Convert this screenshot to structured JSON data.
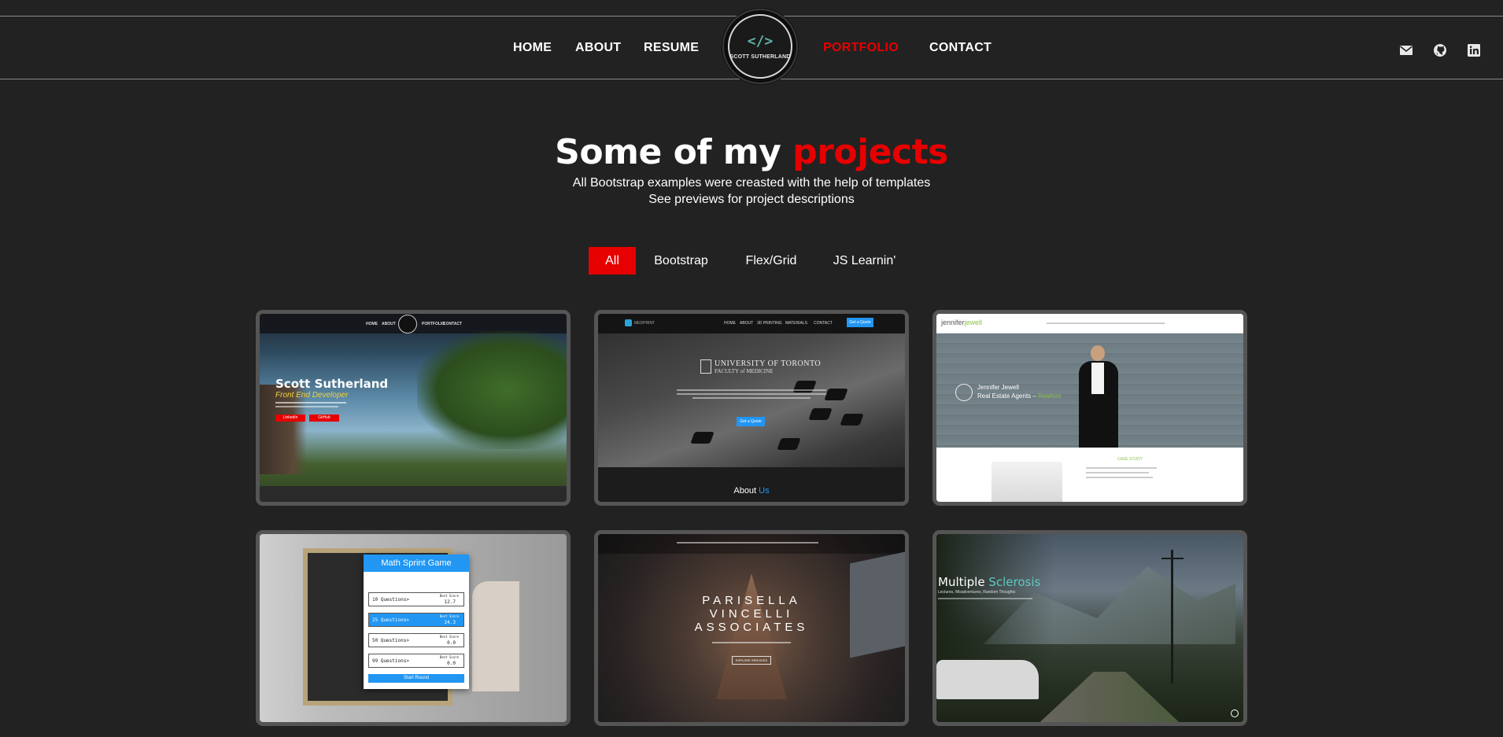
{
  "nav": {
    "left": [
      "HOME",
      "ABOUT",
      "RESUME"
    ],
    "right": [
      "PORTFOLIO",
      "CONTACT"
    ],
    "active": "PORTFOLIO",
    "logo_code": "</>",
    "logo_name": "SCOTT SUTHERLAND",
    "social_icons": [
      "envelope-icon",
      "github-icon",
      "linkedin-icon"
    ]
  },
  "heading": {
    "prefix": "Some of my",
    "accent": "projects",
    "line1": "All Bootstrap examples were creasted with the help of templates",
    "line2": "See previews for project descriptions"
  },
  "filters": [
    "All",
    "Bootstrap",
    "Flex/Grid",
    "JS Learnin'"
  ],
  "active_filter": "All",
  "cards": [
    {
      "title": "Scott Sutherland",
      "subtitle": "Front End Developer",
      "buttons": [
        "LinkedIn",
        "GitHub"
      ],
      "nav": [
        "HOME",
        "ABOUT",
        "PORTFOLIO",
        "CONTACT"
      ]
    },
    {
      "brand": "MEDPRINT",
      "nav": [
        "HOME",
        "ABOUT",
        "3D PRINTING",
        "MATERIALS",
        "CONTACT"
      ],
      "nav_button": "Get a Quote",
      "university": "UNIVERSITY OF TORONTO",
      "faculty": "FACULTY of MEDICINE",
      "button": "Get a Quote",
      "footer": "About",
      "footer_accent": "Us"
    },
    {
      "brand_prefix": "jennifer",
      "brand_accent": "jewell",
      "name": "Jennifer Jewell",
      "tagline": "Real Estate Agents –",
      "tagline_accent": "Realtors",
      "section": "CASE STUDY"
    },
    {
      "title": "Math Sprint Game",
      "options": [
        {
          "label": "10 Questions>",
          "score_label": "Best Score",
          "score": "12.7"
        },
        {
          "label": "25 Questions>",
          "score_label": "Best Score",
          "score": "24.3"
        },
        {
          "label": "50 Questions>",
          "score_label": "Best Score",
          "score": "0.0"
        },
        {
          "label": "99 Questions>",
          "score_label": "Best Score",
          "score": "0.0"
        }
      ],
      "button": "Start Round"
    },
    {
      "name_lines": [
        "PARISELLA",
        "VINCELLI",
        "ASSOCIATES"
      ],
      "button": "EXPLORE SERVICES"
    },
    {
      "title_prefix": "Multiple",
      "title_accent": "Sclerosis",
      "subtitle": "Lectures, Misadventures, Random Thoughts"
    }
  ],
  "colors": {
    "background": "#222222",
    "accent": "#e60000",
    "card_border": "#555555"
  }
}
